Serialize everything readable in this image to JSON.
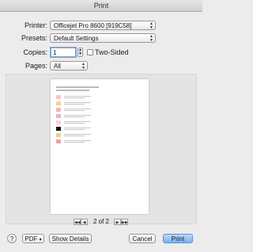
{
  "window": {
    "title": "Print"
  },
  "printer": {
    "label": "Printer:",
    "value": "Officejet Pro 8600 [919C58]"
  },
  "presets": {
    "label": "Presets:",
    "value": "Default Settings"
  },
  "copies": {
    "label": "Copies:",
    "value": "1",
    "two_sided_label": "Two-Sided"
  },
  "pages": {
    "label": "Pages:",
    "value": "All"
  },
  "pager": {
    "text": "2 of 2"
  },
  "buttons": {
    "help": "?",
    "pdf": "PDF",
    "show_details": "Show Details",
    "cancel": "Cancel",
    "print": "Print"
  },
  "colors": {
    "accent": "#7fb0ec",
    "swatches": [
      "#f0c9c3",
      "#e9d59a",
      "#e9b6c5",
      "#e7b3c9",
      "#f2d3dc",
      "#111111",
      "#e5d38e",
      "#e3a5b7"
    ]
  }
}
